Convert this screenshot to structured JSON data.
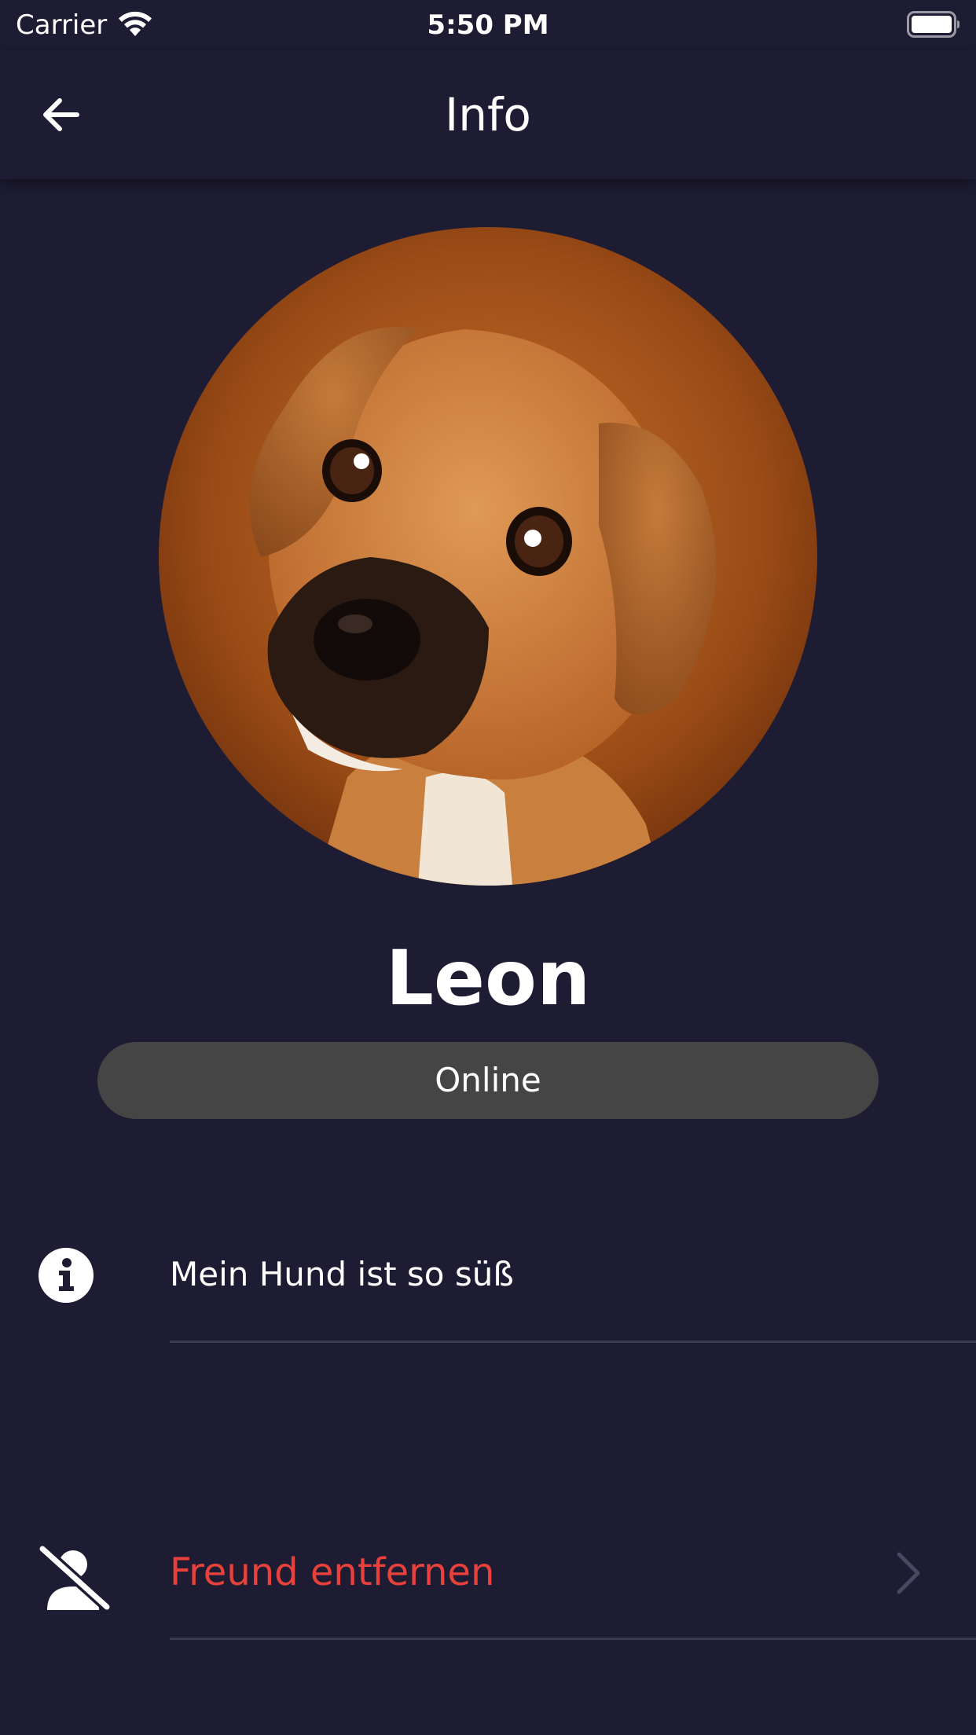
{
  "status_bar": {
    "carrier": "Carrier",
    "time": "5:50 PM"
  },
  "nav": {
    "title": "Info",
    "back_icon": "arrow-left-icon"
  },
  "profile": {
    "name": "Leon",
    "status": "Online",
    "avatar_description_icon": "dog-photo-avatar"
  },
  "rows": {
    "about": {
      "icon": "info-icon",
      "text": "Mein Hund ist so süß"
    },
    "remove_friend": {
      "icon": "person-off-icon",
      "label": "Freund entfernen",
      "chevron_icon": "chevron-right-icon"
    }
  },
  "colors": {
    "background": "#1e1c33",
    "pill": "#454545",
    "danger": "#e8413c",
    "divider": "#3d3b52"
  }
}
